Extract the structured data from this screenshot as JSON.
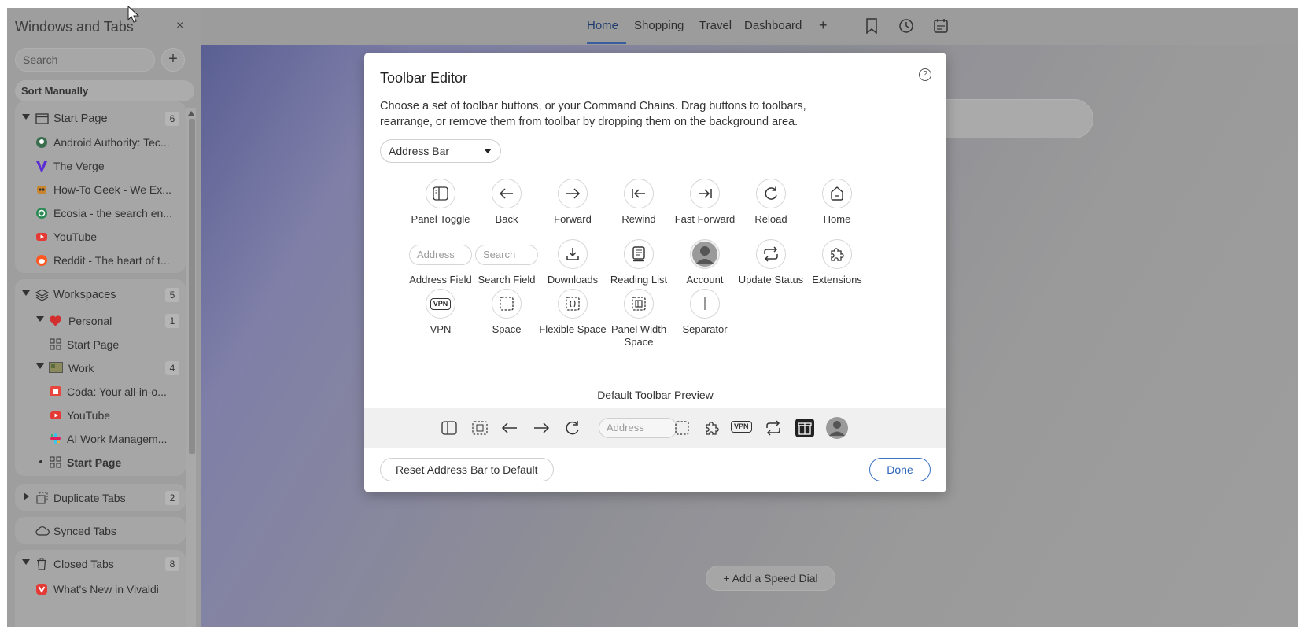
{
  "panel": {
    "title": "Windows and Tabs",
    "close_glyph": "×",
    "search_placeholder": "Search",
    "add_glyph": "+",
    "sort_label": "Sort Manually",
    "start_page": {
      "label": "Start Page",
      "count": "6",
      "tabs": [
        {
          "label": "Android Authority: Tec...",
          "icon": "android-authority-favicon",
          "color": "#3b6d4f"
        },
        {
          "label": "The Verge",
          "icon": "verge-favicon",
          "color": "#5b2bd6"
        },
        {
          "label": "How-To Geek - We Ex...",
          "icon": "howtogeek-favicon",
          "color": "#c9852b"
        },
        {
          "label": "Ecosia - the search en...",
          "icon": "ecosia-favicon",
          "color": "#2e8b57"
        },
        {
          "label": "YouTube",
          "icon": "youtube-favicon",
          "color": "#e53935"
        },
        {
          "label": "Reddit - The heart of t...",
          "icon": "reddit-favicon",
          "color": "#ff5722"
        }
      ]
    },
    "workspaces": {
      "label": "Workspaces",
      "count": "5",
      "personal": {
        "label": "Personal",
        "count": "1",
        "color": "#d32f2f",
        "tabs": [
          {
            "label": "Start Page"
          }
        ]
      },
      "work": {
        "label": "Work",
        "count": "4",
        "tabs": [
          {
            "label": "Coda: Your all-in-o...",
            "icon": "coda-favicon",
            "color": "#e8453c"
          },
          {
            "label": "YouTube",
            "icon": "youtube-favicon",
            "color": "#e53935"
          },
          {
            "label": "AI Work Managem...",
            "icon": "slack-favicon",
            "color": "#4a154b"
          },
          {
            "label": "Start Page",
            "icon": "speed-dial-icon"
          }
        ]
      }
    },
    "duplicate_tabs": {
      "label": "Duplicate Tabs",
      "count": "2"
    },
    "synced_tabs": {
      "label": "Synced Tabs"
    },
    "closed_tabs": {
      "label": "Closed Tabs",
      "count": "8",
      "first": {
        "label": "What's New in Vivaldi",
        "color": "#e53935"
      }
    }
  },
  "tabbar": {
    "tabs": [
      "Home",
      "Shopping",
      "Travel",
      "Dashboard"
    ],
    "active_tab": "Home",
    "add_glyph": "+",
    "icons": [
      "bookmark-icon",
      "history-icon",
      "calendar-icon"
    ]
  },
  "speed_dial": {
    "label": "+  Add a Speed Dial"
  },
  "dialog": {
    "title": "Toolbar Editor",
    "help_glyph": "?",
    "description": "Choose a set of toolbar buttons, or your Command Chains. Drag buttons to toolbars, rearrange, or remove them from toolbar by dropping them on the background area.",
    "select_value": "Address Bar",
    "buttons": [
      {
        "label": "Panel Toggle",
        "icon": "panel-toggle-icon"
      },
      {
        "label": "Back",
        "icon": "back-arrow-icon"
      },
      {
        "label": "Forward",
        "icon": "forward-arrow-icon"
      },
      {
        "label": "Rewind",
        "icon": "rewind-icon"
      },
      {
        "label": "Fast Forward",
        "icon": "fast-forward-icon"
      },
      {
        "label": "Reload",
        "icon": "reload-icon"
      },
      {
        "label": "Home",
        "icon": "home-icon"
      },
      {
        "label": "Address Field",
        "placeholder": "Address"
      },
      {
        "label": "Search Field",
        "placeholder": "Search"
      },
      {
        "label": "Downloads",
        "icon": "downloads-icon"
      },
      {
        "label": "Reading List",
        "icon": "reading-list-icon"
      },
      {
        "label": "Account",
        "icon": "account-avatar-icon"
      },
      {
        "label": "Update Status",
        "icon": "update-status-icon"
      },
      {
        "label": "Extensions",
        "icon": "extensions-puzzle-icon"
      },
      {
        "label": "VPN",
        "icon": "vpn-icon",
        "badge": "VPN"
      },
      {
        "label": "Space",
        "icon": "space-icon"
      },
      {
        "label": "Flexible Space",
        "icon": "flexible-space-icon"
      },
      {
        "label": "Panel Width Space",
        "icon": "panel-width-space-icon"
      },
      {
        "label": "Separator",
        "icon": "separator-icon"
      }
    ],
    "preview_label": "Default Toolbar Preview",
    "preview_address_placeholder": "Address",
    "preview_vpn_badge": "VPN",
    "reset_label": "Reset Address Bar to Default",
    "done_label": "Done"
  }
}
